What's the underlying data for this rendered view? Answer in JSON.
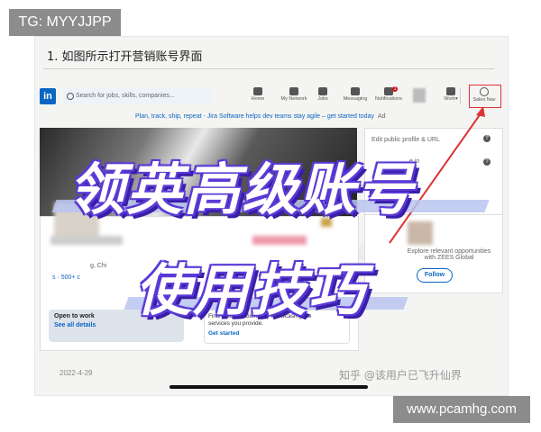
{
  "tag_label": "TG: MYYJJPP",
  "step_title": "1. 如图所示打开营销账号界面",
  "linkedin": {
    "logo": "in",
    "search_placeholder": "Search for jobs, skills, companies...",
    "nav": [
      "Home",
      "My Network",
      "Jobs",
      "Messaging",
      "Notifications",
      "Work▾",
      "Sales Nav"
    ],
    "notification_count": "1",
    "ad_text": "Plan, track, ship, repeat - Jira Software helps dev teams stay agile – get started today",
    "ad_label": "Ad",
    "location_partial": "g, Chi",
    "skills_partial": "s · 500+ c",
    "open_to_work_title": "Open to work",
    "open_to_work_link": "See all details",
    "find_clients_text": "Find potential clients by showcasing the services you provide.",
    "find_clients_link": "Get started",
    "side_profile_text": "Edit public profile & URL",
    "side_in_text": "e in",
    "side_explore_text": "Explore relevant opportunities with ZEES Global",
    "follow_label": "Follow"
  },
  "overlay": {
    "line1": "领英高级账号",
    "line2": "使用技巧"
  },
  "date": "2022-4-29",
  "watermark": "知乎 @该用户已飞升仙界",
  "site_label": "www.pcamhg.com",
  "colors": {
    "linkedin_blue": "#0a66c2",
    "overlay_purple": "#5b3bd6",
    "highlight_red": "#dd3333"
  }
}
